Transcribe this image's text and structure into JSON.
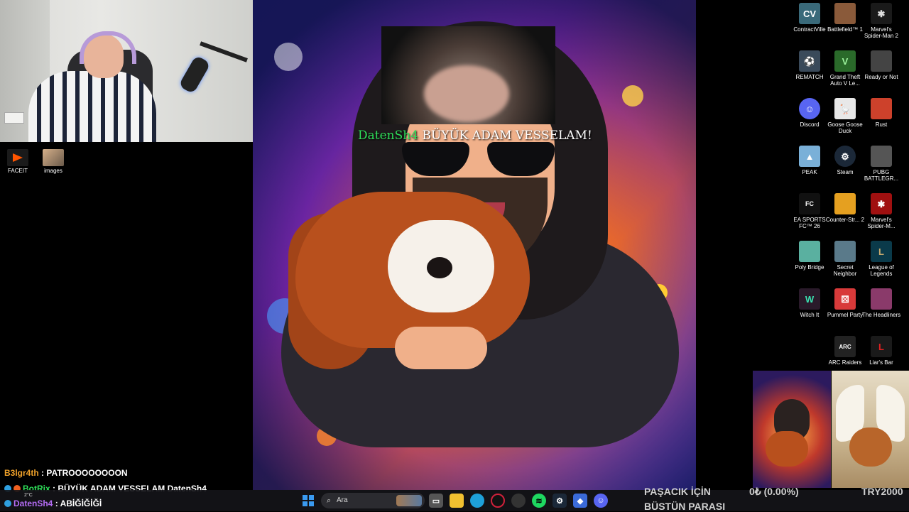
{
  "desktop_left_icons": [
    {
      "label": "FACEIT",
      "icon": "faceit-icon",
      "color": "#1a1a1a"
    },
    {
      "label": "images",
      "icon": "image-folder-icon",
      "color": "#8a6a4a"
    }
  ],
  "stream_alert": {
    "username": "DatenSh4",
    "message": "BÜYÜK ADAM VESSELAM!",
    "username_color": "#2fe05a"
  },
  "desktop_right_icons": [
    {
      "label": "ContractVille",
      "glyph": "CV",
      "color": "#3a6a7a"
    },
    {
      "label": "Battlefield™ 1",
      "glyph": "",
      "color": "#8a5a3a"
    },
    {
      "label": "Marvel's Spider-Man 2",
      "glyph": "",
      "color": "#1a1a1a"
    },
    {
      "label": "REMATCH",
      "glyph": "",
      "color": "#3a4a5a"
    },
    {
      "label": "Grand Theft Auto V Le...",
      "glyph": "V",
      "color": "#2a6a2a"
    },
    {
      "label": "Ready or Not",
      "glyph": "",
      "color": "#444"
    },
    {
      "label": "Discord",
      "glyph": "",
      "color": "#5865f2"
    },
    {
      "label": "Goose Goose Duck",
      "glyph": "",
      "color": "#e8e8e8"
    },
    {
      "label": "Rust",
      "glyph": "",
      "color": "#cd412b"
    },
    {
      "label": "PEAK",
      "glyph": "",
      "color": "#7ab0d8"
    },
    {
      "label": "Steam",
      "glyph": "",
      "color": "#1b2838"
    },
    {
      "label": "PUBG BATTLEGR...",
      "glyph": "",
      "color": "#555"
    },
    {
      "label": "EA SPORTS FC™ 26",
      "glyph": "FC",
      "color": "#111"
    },
    {
      "label": "Counter-Str... 2",
      "glyph": "",
      "color": "#e5a020"
    },
    {
      "label": "Marvel's Spider-M...",
      "glyph": "",
      "color": "#a01010"
    },
    {
      "label": "Poly Bridge",
      "glyph": "",
      "color": "#5ab0a0"
    },
    {
      "label": "Secret Neighbor",
      "glyph": "",
      "color": "#5a7a8a"
    },
    {
      "label": "League of Legends",
      "glyph": "",
      "color": "#0a3a4a"
    },
    {
      "label": "Witch It",
      "glyph": "W",
      "color": "#2a1a2a"
    },
    {
      "label": "Pummel Party",
      "glyph": "",
      "color": "#d83a3a"
    },
    {
      "label": "The Headliners",
      "glyph": "",
      "color": "#8a3a6a"
    },
    {
      "label": "ARC Raiders",
      "glyph": "ARC",
      "color": "#222"
    },
    {
      "label": "Liar's Bar",
      "glyph": "L",
      "color": "#1a1a1a"
    }
  ],
  "chat": [
    {
      "user": "B3lgr4th",
      "text": "PATROOOOOOOON",
      "name_color": "#f0a22a"
    },
    {
      "user": "BotRix",
      "text": "BÜYÜK ADAM VESSELAM DatenSh4",
      "name_color": "#2fe05a"
    },
    {
      "user": "DatenSh4",
      "text": "ABİĞİĞİĞİ",
      "name_color": "#b46cf5"
    }
  ],
  "weather": {
    "temp": "2°C"
  },
  "taskbar": {
    "search_placeholder": "Ara",
    "apps": [
      {
        "name": "task-view-icon",
        "color": "#555"
      },
      {
        "name": "file-explorer-icon",
        "color": "#f0c030"
      },
      {
        "name": "edge-icon",
        "color": "#1ea0d8"
      },
      {
        "name": "opera-icon",
        "color": "#d0213b"
      },
      {
        "name": "obs-icon",
        "color": "#333"
      },
      {
        "name": "spotify-icon",
        "color": "#1ed760"
      },
      {
        "name": "steam-icon",
        "color": "#1b2838"
      },
      {
        "name": "app-icon",
        "color": "#3a6ad8"
      },
      {
        "name": "discord-icon",
        "color": "#5865f2"
      }
    ]
  },
  "donation": {
    "title_line1": "PAŞACIK İÇİN",
    "title_line2": "BÜSTÜN PARASI",
    "amount": "0₺ (0.00%)",
    "goal": "TRY2000"
  }
}
